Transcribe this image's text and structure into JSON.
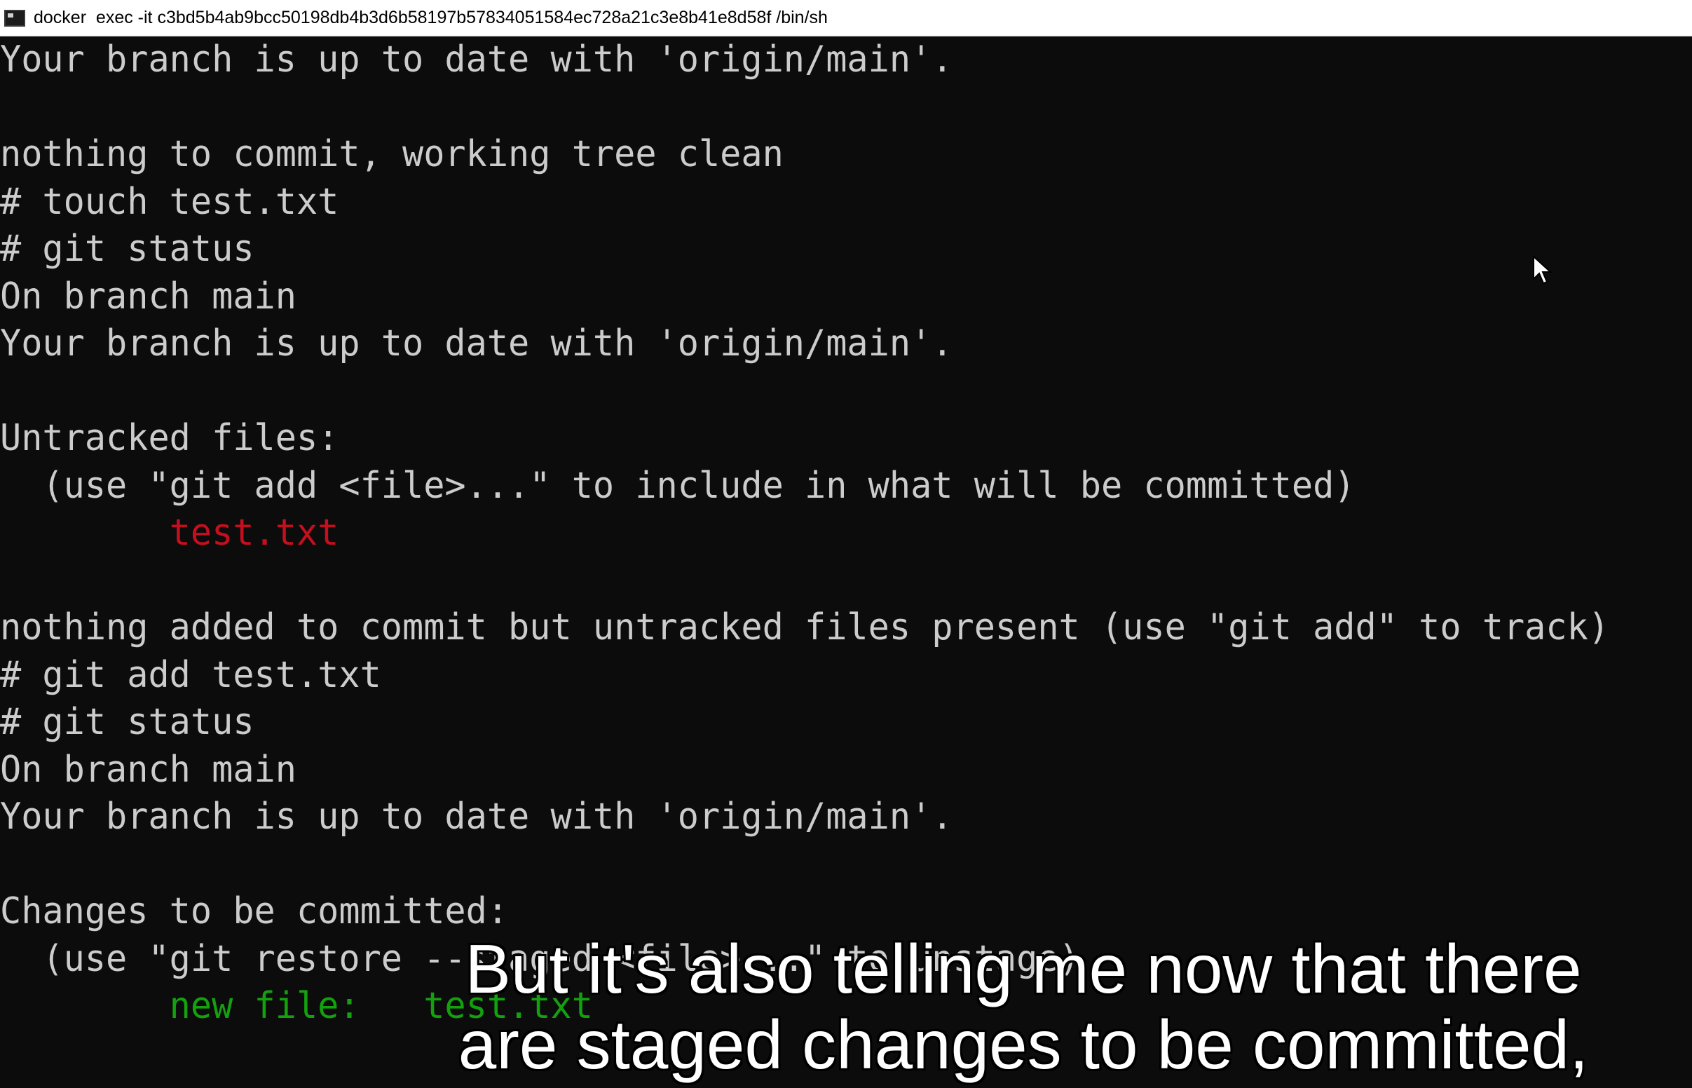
{
  "window": {
    "title": "docker  exec -it c3bd5b4ab9bcc50198db4b3d6b58197b57834051584ec728a21c3e8b41e8d58f /bin/sh",
    "icon": "terminal-icon"
  },
  "terminal": {
    "lines": [
      {
        "text": "Your branch is up to date with 'origin/main'."
      },
      {
        "text": ""
      },
      {
        "text": "nothing to commit, working tree clean"
      },
      {
        "text": "# touch test.txt"
      },
      {
        "text": "# git status"
      },
      {
        "text": "On branch main"
      },
      {
        "text": "Your branch is up to date with 'origin/main'."
      },
      {
        "text": ""
      },
      {
        "text": "Untracked files:"
      },
      {
        "text": "  (use \"git add <file>...\" to include in what will be committed)"
      },
      {
        "prefix": "        ",
        "text": "test.txt",
        "color": "#c50f1f"
      },
      {
        "text": ""
      },
      {
        "text": "nothing added to commit but untracked files present (use \"git add\" to track)"
      },
      {
        "text": "# git add test.txt"
      },
      {
        "text": "# git status"
      },
      {
        "text": "On branch main"
      },
      {
        "text": "Your branch is up to date with 'origin/main'."
      },
      {
        "text": ""
      },
      {
        "text": "Changes to be committed:"
      },
      {
        "text": "  (use \"git restore --staged <file>...\" to unstage)"
      },
      {
        "prefix": "        ",
        "text": "new file:   test.txt",
        "color": "#13a10e"
      }
    ]
  },
  "subtitle": {
    "line1": "But it's also telling me now that there",
    "line2": "are staged changes to be committed,"
  },
  "colors": {
    "background": "#0c0c0c",
    "text": "#cccccc",
    "untracked": "#c50f1f",
    "staged": "#13a10e"
  }
}
